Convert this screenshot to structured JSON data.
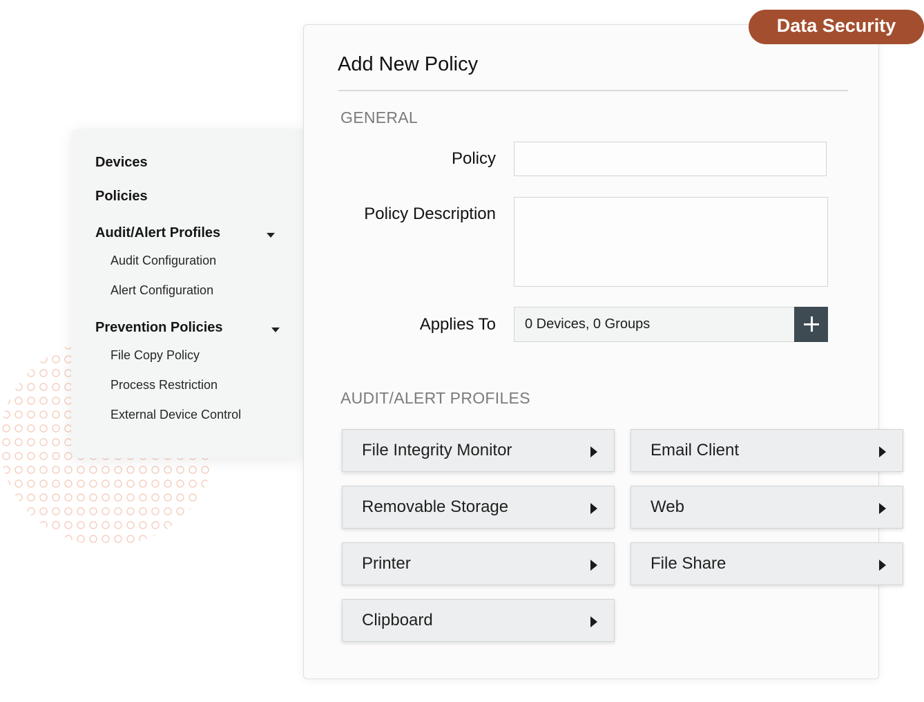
{
  "badge": {
    "label": "Data Security"
  },
  "sidebar": {
    "items": [
      {
        "label": "Devices"
      },
      {
        "label": "Policies"
      },
      {
        "label": "Audit/Alert Profiles",
        "children": [
          "Audit Configuration",
          "Alert Configuration"
        ]
      },
      {
        "label": "Prevention Policies",
        "children": [
          "File Copy Policy",
          "Process Restriction",
          "External Device Control"
        ]
      }
    ]
  },
  "form": {
    "title": "Add New Policy",
    "general_section": "GENERAL",
    "policy_label": "Policy",
    "policy_value": "",
    "description_label": "Policy Description",
    "description_value": "",
    "applies_to_label": "Applies To",
    "applies_to_value": "0 Devices, 0 Groups",
    "profiles_section": "AUDIT/ALERT PROFILES",
    "profiles": [
      "File Integrity Monitor",
      "Email Client",
      "Removable Storage",
      "Web",
      "Printer",
      "File Share",
      "Clipboard"
    ]
  }
}
